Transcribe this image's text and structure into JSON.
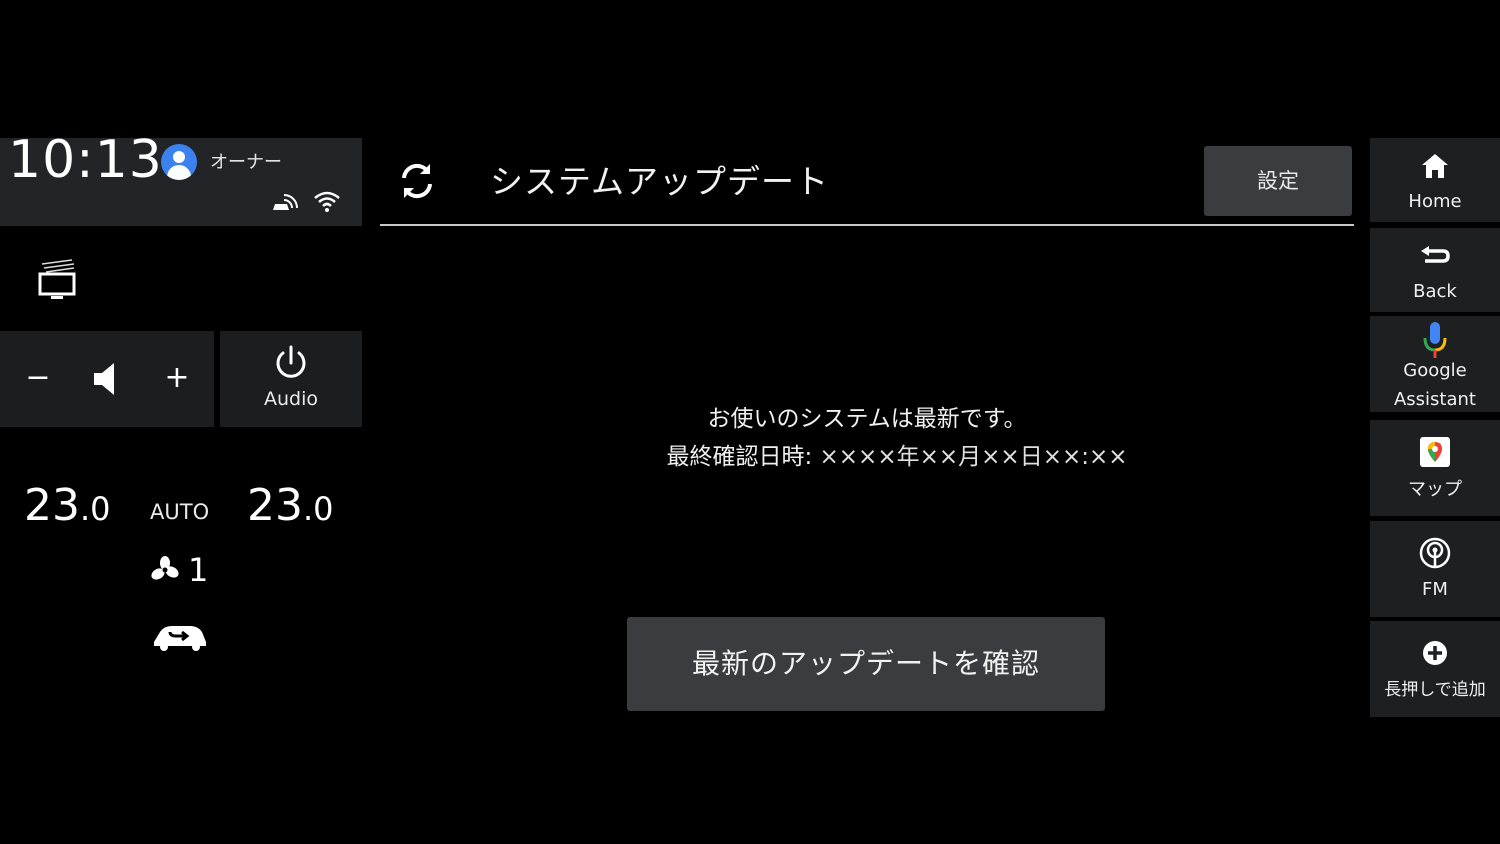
{
  "status": {
    "time": "10:13",
    "user_label": "オーナー"
  },
  "volume": {
    "minus_label": "−",
    "plus_label": "+"
  },
  "audio": {
    "label": "Audio"
  },
  "climate": {
    "left_temp_int": "23",
    "left_temp_dec": ".0",
    "right_temp_int": "23",
    "right_temp_dec": ".0",
    "mode": "AUTO",
    "fan_level": "1"
  },
  "header": {
    "title": "システムアップデート",
    "settings_label": "設定"
  },
  "main": {
    "status_message": "お使いのシステムは最新です。",
    "last_checked_label": "最終確認日時:",
    "last_checked_value": "××××年××月××日××:××",
    "check_button_label": "最新のアップデートを確認"
  },
  "nav": {
    "home": "Home",
    "back": "Back",
    "assistant_line1": "Google",
    "assistant_line2": "Assistant",
    "map": "マップ",
    "fm": "FM",
    "add": "長押しで追加"
  },
  "colors": {
    "background": "#000000",
    "panel": "#1c1d1f",
    "button": "#3a3c40",
    "avatar": "#3b82f0"
  }
}
